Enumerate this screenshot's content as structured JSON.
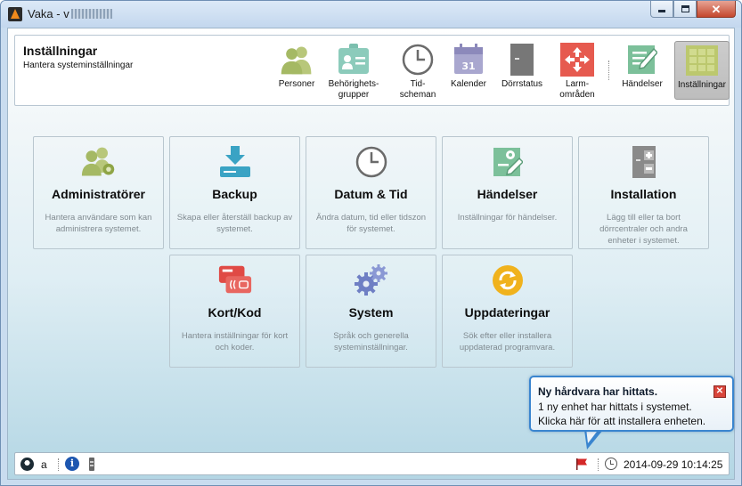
{
  "window": {
    "title": "Vaka - v",
    "controls": {
      "minimize_icon": "minimize-icon",
      "maximize_icon": "maximize-icon",
      "close_icon": "close-icon"
    }
  },
  "header": {
    "title": "Inställningar",
    "subtitle": "Hantera systeminställningar"
  },
  "toolbar": {
    "items": [
      {
        "label": "Personer",
        "icon": "persons-icon"
      },
      {
        "label": "Behörighets-\ngrupper",
        "icon": "access-group-icon"
      },
      {
        "label": "Tid-\nscheman",
        "icon": "clock-icon"
      },
      {
        "label": "Kalender",
        "icon": "calendar-icon"
      },
      {
        "label": "Dörrstatus",
        "icon": "door-icon"
      },
      {
        "label": "Larm-\nområden",
        "icon": "alarm-areas-icon"
      },
      {
        "label": "Händelser",
        "icon": "events-icon"
      },
      {
        "label": "Inställningar",
        "icon": "settings-grid-icon",
        "active": true
      }
    ]
  },
  "cards": [
    {
      "title": "Administratörer",
      "desc": "Hantera användare som kan administrera systemet.",
      "icon": "admins-icon"
    },
    {
      "title": "Backup",
      "desc": "Skapa eller återställ backup av systemet.",
      "icon": "backup-icon"
    },
    {
      "title": "Datum & Tid",
      "desc": "Ändra datum, tid eller tidszon för systemet.",
      "icon": "clock-icon"
    },
    {
      "title": "Händelser",
      "desc": "Inställningar för händelser.",
      "icon": "event-settings-icon"
    },
    {
      "title": "Installation",
      "desc": "Lägg till eller ta bort dörrcentraler och andra enheter i systemet.",
      "icon": "installation-icon"
    },
    {
      "title": "Kort/Kod",
      "desc": "Hantera inställningar för kort och koder.",
      "icon": "cards-icon"
    },
    {
      "title": "System",
      "desc": "Språk och generella systeminställningar.",
      "icon": "gears-icon"
    },
    {
      "title": "Uppdateringar",
      "desc": "Sök efter eller installera uppdaterad programvara.",
      "icon": "update-icon"
    }
  ],
  "status_bar": {
    "user": "a",
    "datetime": "2014-09-29 10:14:25"
  },
  "notification": {
    "title": "Ny hårdvara har hittats.",
    "line1": "1 ny enhet har hittats i systemet.",
    "line2": "Klicka här för att installera enheten."
  },
  "colors": {
    "active_toolbar": "#c4c4c4",
    "accent_green": "#a8c066",
    "accent_teal": "#3aa3c4",
    "accent_red": "#e04a45",
    "accent_orange": "#f0b21d",
    "notification_border": "#3a85cf"
  }
}
